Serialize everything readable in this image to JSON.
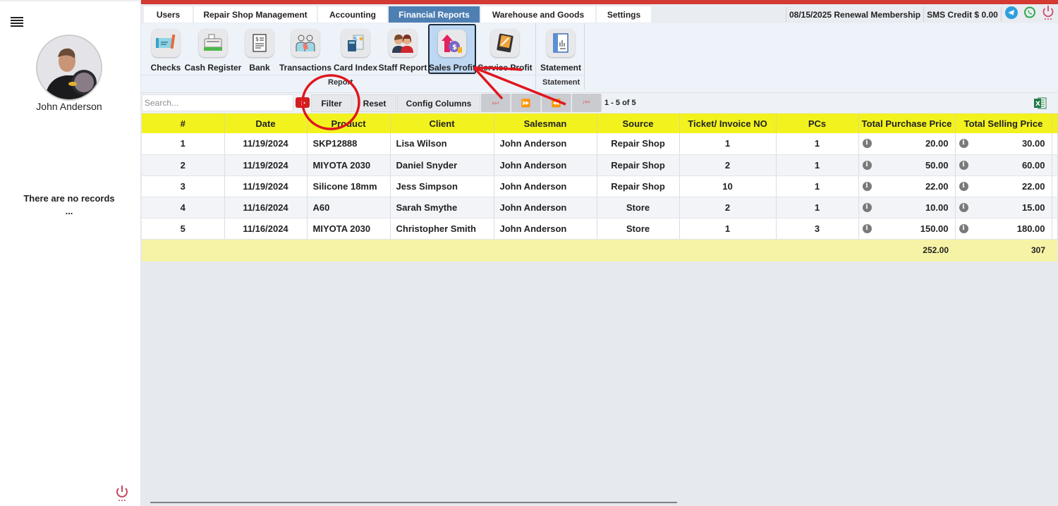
{
  "sidebar": {
    "user_name": "John Anderson",
    "no_records": "There are no records",
    "ellipsis": "...",
    "menu_icon": "hamburger-icon",
    "power_icon": "power-icon"
  },
  "menu": {
    "tabs": [
      {
        "label": "Users",
        "active": false
      },
      {
        "label": "Repair Shop Management",
        "active": false
      },
      {
        "label": "Accounting",
        "active": false
      },
      {
        "label": "Financial Reports",
        "active": true
      },
      {
        "label": "Warehouse and Goods",
        "active": false
      },
      {
        "label": "Settings",
        "active": false
      }
    ],
    "renewal": "08/15/2025 Renewal Membership",
    "sms_credit": "SMS Credit $ 0.00",
    "icons": [
      "telegram-icon",
      "whatsapp-icon",
      "power-icon"
    ]
  },
  "ribbon": {
    "items": [
      {
        "label": "Checks",
        "icon": "check-icon"
      },
      {
        "label": "Cash Register",
        "icon": "cash-register-icon"
      },
      {
        "label": "Bank",
        "icon": "bank-document-icon"
      },
      {
        "label": "Transactions",
        "icon": "transactions-icon"
      },
      {
        "label": "Card Index",
        "icon": "card-index-icon"
      },
      {
        "label": "Staff Report",
        "icon": "staff-icon"
      },
      {
        "label": "Sales Profit",
        "icon": "sales-profit-icon",
        "selected": true
      },
      {
        "label": "Service Profit",
        "icon": "service-profit-icon"
      },
      {
        "label": "Statement",
        "icon": "statement-icon"
      }
    ],
    "groups": [
      {
        "label": "Report"
      },
      {
        "label": "Statement"
      }
    ]
  },
  "toolbar": {
    "search_placeholder": "Search...",
    "filter_label": "Filter",
    "reset_label": "Reset",
    "config_columns_label": "Config Columns",
    "page_count": "1 - 5 of 5"
  },
  "table": {
    "headers": [
      "#",
      "Date",
      "Product",
      "Client",
      "Salesman",
      "Source",
      "Ticket/ Invoice NO",
      "PCs",
      "Total Purchase Price",
      "Total Selling Price"
    ],
    "rows": [
      [
        "1",
        "11/19/2024",
        "SKP12888",
        "Lisa Wilson",
        "John Anderson",
        "Repair Shop",
        "1",
        "1",
        "20.00",
        "30.00"
      ],
      [
        "2",
        "11/19/2024",
        "MIYOTA 2030",
        "Daniel Snyder",
        "John Anderson",
        "Repair Shop",
        "2",
        "1",
        "50.00",
        "60.00"
      ],
      [
        "3",
        "11/19/2024",
        "Silicone 18mm",
        "Jess Simpson",
        "John Anderson",
        "Repair Shop",
        "10",
        "1",
        "22.00",
        "22.00"
      ],
      [
        "4",
        "11/16/2024",
        "A60",
        "Sarah Smythe",
        "John Anderson",
        "Store",
        "2",
        "1",
        "10.00",
        "15.00"
      ],
      [
        "5",
        "11/16/2024",
        "MIYOTA 2030",
        "Christopher Smith",
        "John Anderson",
        "Store",
        "1",
        "3",
        "150.00",
        "180.00"
      ]
    ],
    "totals": {
      "purchase": "252.00",
      "selling": "307"
    },
    "info_glyph": "i"
  },
  "colors": {
    "accent_red": "#d23a33",
    "active_tab": "#4e7fb3",
    "header_yellow": "#f2f21f",
    "totals_yellow": "#f6f3a6",
    "annotation_red": "#e0161e"
  }
}
